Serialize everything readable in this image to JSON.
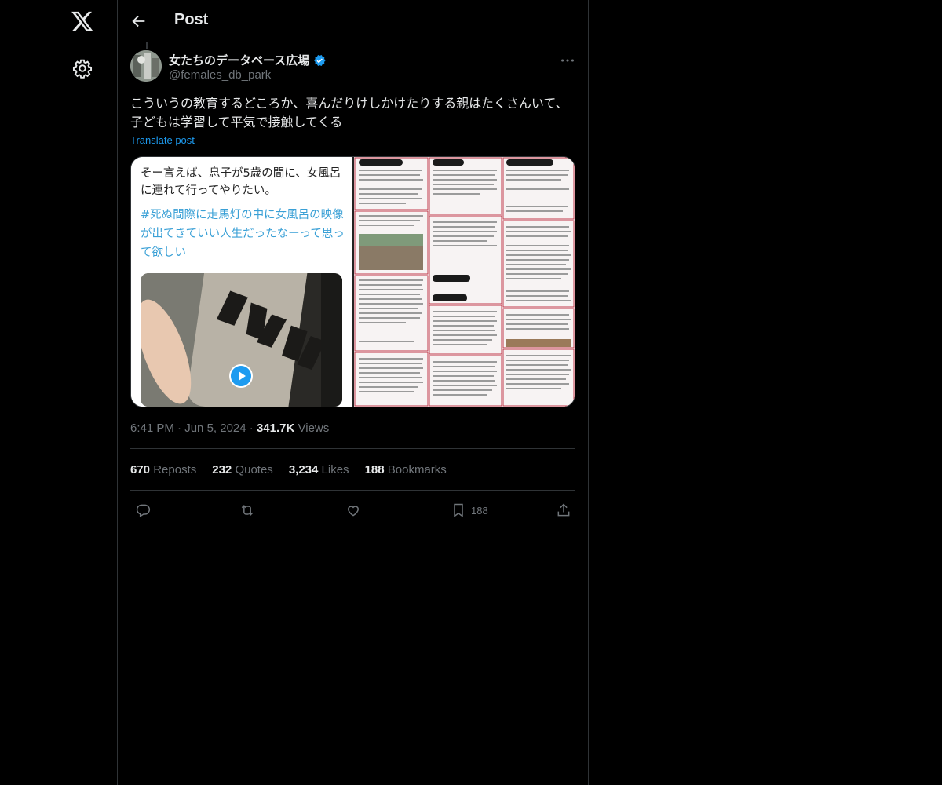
{
  "header": {
    "title": "Post"
  },
  "author": {
    "display_name": "女たちのデータベース広場",
    "handle": "@females_db_park",
    "verified": true
  },
  "post": {
    "text": "こういうの教育するどころか、喜んだりけしかけたりする親はたくさんいて、子どもは学習して平気で接触してくる",
    "translate_label": "Translate post"
  },
  "media": {
    "caption_black": "そー言えば、息子が5歳の間に、女風呂に連れて行ってやりたい。",
    "caption_blue": "#死ぬ間際に走馬灯の中に女風呂の映像が出てきていい人生だったなーって思って欲しい",
    "has_video": true
  },
  "meta": {
    "time": "6:41 PM",
    "date": "Jun 5, 2024",
    "views_count": "341.7K",
    "views_label": "Views"
  },
  "stats": {
    "reposts_count": "670",
    "reposts_label": "Reposts",
    "quotes_count": "232",
    "quotes_label": "Quotes",
    "likes_count": "3,234",
    "likes_label": "Likes",
    "bookmarks_count": "188",
    "bookmarks_label": "Bookmarks"
  },
  "actions": {
    "bookmark_count": "188"
  },
  "icons": [
    "x-logo-icon",
    "gear-icon",
    "back-arrow-icon",
    "verified-icon",
    "more-icon",
    "play-icon",
    "reply-icon",
    "repost-icon",
    "like-icon",
    "bookmark-icon",
    "share-icon"
  ],
  "colors": {
    "background": "#000000",
    "text": "#e7e9ea",
    "muted": "#71767b",
    "accent": "#1d9bf0",
    "border": "#2f3336"
  }
}
